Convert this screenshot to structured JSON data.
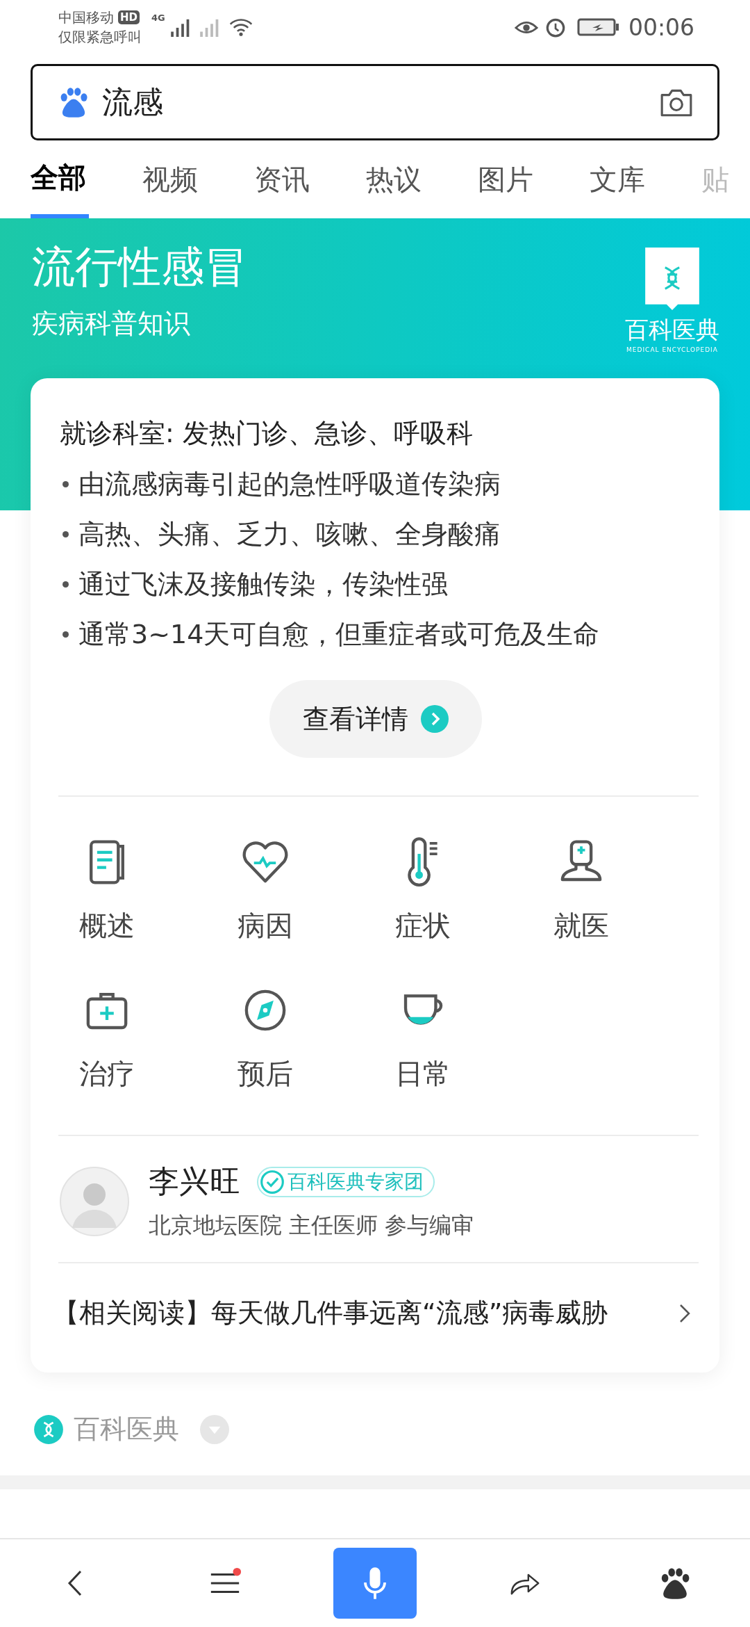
{
  "status_bar": {
    "carrier": "中国移动",
    "hd": "HD",
    "emergency": "仅限紧急呼叫",
    "network": "4G",
    "time": "00:06"
  },
  "search": {
    "value": "流感"
  },
  "tabs": [
    {
      "label": "全部",
      "selected": true
    },
    {
      "label": "视频",
      "selected": false
    },
    {
      "label": "资讯",
      "selected": false
    },
    {
      "label": "热议",
      "selected": false
    },
    {
      "label": "图片",
      "selected": false
    },
    {
      "label": "文库",
      "selected": false
    },
    {
      "label": "贴",
      "selected": false
    }
  ],
  "header": {
    "title": "流行性感冒",
    "subtitle": "疾病科普知识",
    "logo_title": "百科医典",
    "logo_subtitle": "MEDICAL ENCYCLOPEDIA"
  },
  "card": {
    "department": "就诊科室: 发热门诊、急诊、呼吸科",
    "bullets": [
      "由流感病毒引起的急性呼吸道传染病",
      "高热、头痛、乏力、咳嗽、全身酸痛",
      "通过飞沫及接触传染，传染性强",
      "通常3~14天可自愈，但重症者或可危及生命"
    ],
    "details_button": "查看详情",
    "sections": [
      {
        "label": "概述",
        "kind": "document"
      },
      {
        "label": "病因",
        "kind": "heart"
      },
      {
        "label": "症状",
        "kind": "thermometer"
      },
      {
        "label": "就医",
        "kind": "doctor"
      },
      {
        "label": "治疗",
        "kind": "kit"
      },
      {
        "label": "预后",
        "kind": "compass"
      },
      {
        "label": "日常",
        "kind": "cup"
      }
    ],
    "expert": {
      "name": "李兴旺",
      "badge": "百科医典专家团",
      "affiliation": "北京地坛医院 主任医师 参与编审"
    },
    "related": "【相关阅读】每天做几件事远离“流感”病毒威胁"
  },
  "source": {
    "name": "百科医典"
  },
  "bottom_nav": [
    {
      "kind": "back"
    },
    {
      "kind": "menu",
      "notification": true
    },
    {
      "kind": "voice"
    },
    {
      "kind": "share"
    },
    {
      "kind": "home"
    }
  ]
}
